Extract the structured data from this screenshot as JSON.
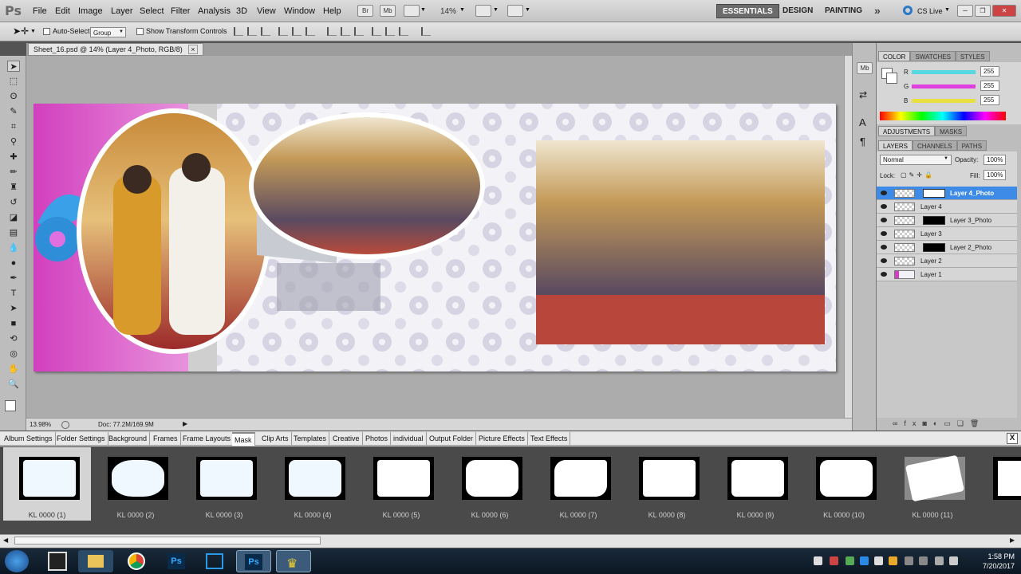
{
  "app": {
    "logo": "Ps"
  },
  "menu": [
    "File",
    "Edit",
    "Image",
    "Layer",
    "Select",
    "Filter",
    "Analysis",
    "3D",
    "View",
    "Window",
    "Help"
  ],
  "appbar": {
    "br": "Br",
    "mb": "Mb",
    "zoom": "14%"
  },
  "workspaces": [
    "ESSENTIALS",
    "DESIGN",
    "PAINTING"
  ],
  "more_label": "»",
  "cslive": "CS Live",
  "options": {
    "auto_select_label": "Auto-Select:",
    "auto_select_value": "Group",
    "transform_label": "Show Transform Controls"
  },
  "document": {
    "tab_title": "Sheet_16.psd @ 14% (Layer 4_Photo, RGB/8)",
    "close": "×"
  },
  "status": {
    "zoom": "13.98%",
    "doc": "Doc: 77.2M/169.9M"
  },
  "color_panel": {
    "tabs": [
      "COLOR",
      "SWATCHES",
      "STYLES"
    ],
    "channels": [
      {
        "label": "R",
        "value": "255",
        "color": "#56d8e0"
      },
      {
        "label": "G",
        "value": "255",
        "color": "#e040e0"
      },
      {
        "label": "B",
        "value": "255",
        "color": "#e8e040"
      }
    ]
  },
  "adjust_tabs": [
    "ADJUSTMENTS",
    "MASKS"
  ],
  "layers_panel": {
    "tabs": [
      "LAYERS",
      "CHANNELS",
      "PATHS"
    ],
    "blend_mode": "Normal",
    "opacity_label": "Opacity:",
    "opacity": "100%",
    "lock_label": "Lock:",
    "fill_label": "Fill:",
    "fill": "100%",
    "layers": [
      {
        "name": "Layer 4_Photo",
        "selected": true,
        "mask": true
      },
      {
        "name": "Layer 4",
        "selected": false,
        "mask": false
      },
      {
        "name": "Layer 3_Photo",
        "selected": false,
        "mask": true
      },
      {
        "name": "Layer 3",
        "selected": false,
        "mask": false
      },
      {
        "name": "Layer 2_Photo",
        "selected": false,
        "mask": true
      },
      {
        "name": "Layer 2",
        "selected": false,
        "mask": false
      },
      {
        "name": "Layer 1",
        "selected": false,
        "mask": false
      }
    ]
  },
  "bottom_tabs": [
    "Album Settings",
    "Folder Settings",
    "Background",
    "Frames",
    "Frame Layouts",
    "Mask",
    "Clip Arts",
    "Templates",
    "Creative",
    "Photos",
    "individual",
    "Output Folder",
    "Picture Effects",
    "Text Effects"
  ],
  "active_bottom_tab": "Mask",
  "gallery_close": "X",
  "gallery": [
    "KL 0000 (1)",
    "KL 0000 (2)",
    "KL 0000 (3)",
    "KL 0000 (4)",
    "KL 0000 (5)",
    "KL 0000 (6)",
    "KL 0000 (7)",
    "KL 0000 (8)",
    "KL 0000 (9)",
    "KL 0000 (10)",
    "KL 0000 (11)"
  ],
  "taskbar": {
    "time": "1:58 PM",
    "date": "7/20/2017",
    "apps": [
      "file-explorer",
      "chrome",
      "photoshop",
      "snipping-tool",
      "photoshop",
      "crown-app"
    ]
  }
}
